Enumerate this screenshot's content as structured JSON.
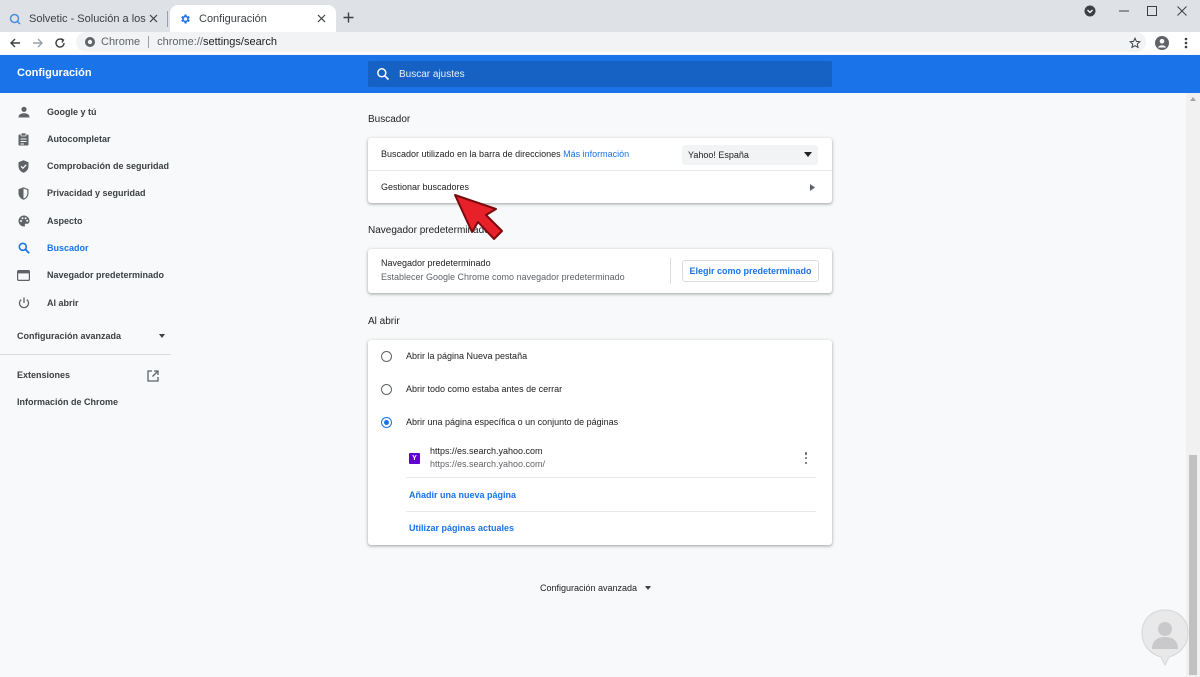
{
  "browser": {
    "tabs": [
      {
        "title": "Solvetic - Solución a los problemas",
        "favicon": "solvetic-icon",
        "active": false
      },
      {
        "title": "Configuración",
        "favicon": "gear-icon",
        "active": true
      }
    ],
    "omnibox": {
      "site_label": "Chrome",
      "url_scheme": "chrome://",
      "url_path": "settings/search"
    }
  },
  "header": {
    "title": "Configuración",
    "search_placeholder": "Buscar ajustes"
  },
  "sidebar": {
    "items": [
      {
        "label": "Google y tú",
        "icon": "person-icon"
      },
      {
        "label": "Autocompletar",
        "icon": "clipboard-icon"
      },
      {
        "label": "Comprobación de seguridad",
        "icon": "shield-check-icon"
      },
      {
        "label": "Privacidad y seguridad",
        "icon": "shield-icon"
      },
      {
        "label": "Aspecto",
        "icon": "palette-icon"
      },
      {
        "label": "Buscador",
        "icon": "search-icon",
        "selected": true
      },
      {
        "label": "Navegador predeterminado",
        "icon": "browser-window-icon"
      },
      {
        "label": "Al abrir",
        "icon": "power-icon"
      }
    ],
    "advanced": "Configuración avanzada",
    "extensions": "Extensiones",
    "about": "Información de Chrome"
  },
  "search_engine": {
    "section_title": "Buscador",
    "address_bar_label": "Buscador utilizado en la barra de direcciones",
    "more_info": "Más información",
    "selected_engine": "Yahoo! España",
    "manage_label": "Gestionar buscadores"
  },
  "default_browser": {
    "section_title": "Navegador predeterminado",
    "title": "Navegador predeterminado",
    "subtitle": "Establecer Google Chrome como navegador predeterminado",
    "button": "Elegir como predeterminado"
  },
  "on_startup": {
    "section_title": "Al abrir",
    "options": [
      {
        "label": "Abrir la página Nueva pestaña",
        "checked": false
      },
      {
        "label": "Abrir todo como estaba antes de cerrar",
        "checked": false
      },
      {
        "label": "Abrir una página específica o un conjunto de páginas",
        "checked": true
      }
    ],
    "page": {
      "title": "https://es.search.yahoo.com",
      "url": "https://es.search.yahoo.com/"
    },
    "add_page": "Añadir una nueva página",
    "use_current": "Utilizar páginas actuales"
  },
  "footer": {
    "advanced": "Configuración avanzada"
  },
  "colors": {
    "accent": "#1a73e8",
    "pointer": "#e8202a"
  }
}
